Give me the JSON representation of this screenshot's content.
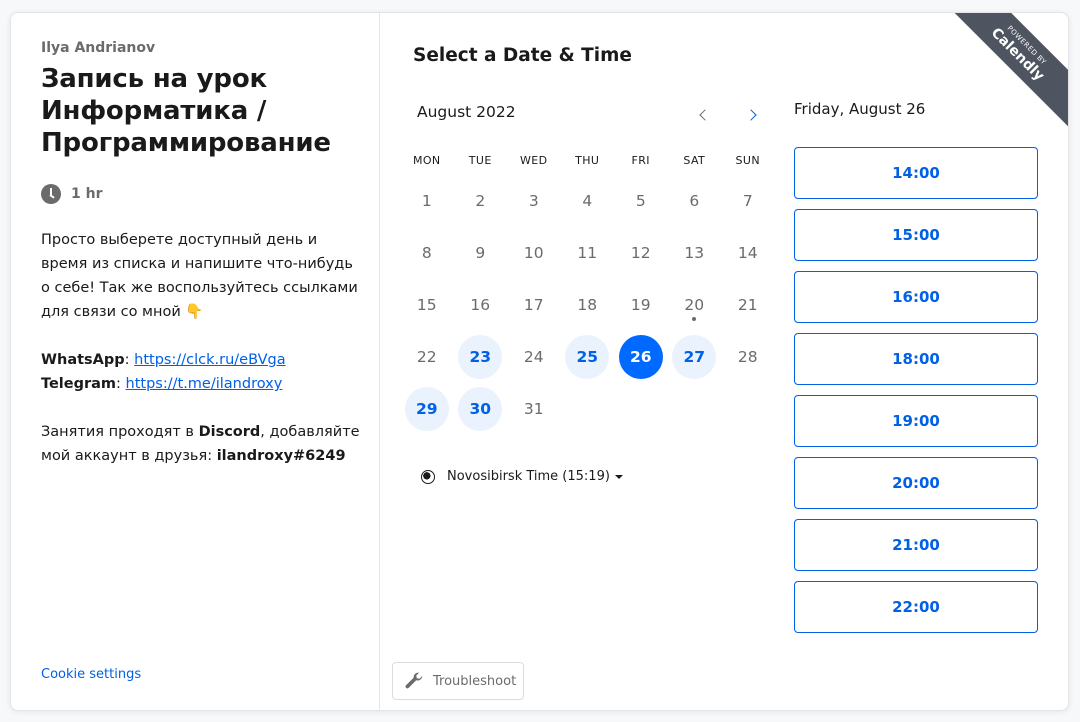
{
  "left": {
    "host_name": "Ilya Andrianov",
    "event_title": "Запись на урок Информатика / Программирование",
    "duration": "1 hr",
    "description": {
      "intro": "Просто выберете доступный день и время из списка и напишите что-нибудь о себе! Так же воспользуйтесь ссылками для связи со мной 👇",
      "whatsapp_label": "WhatsApp",
      "whatsapp_link": "https://clck.ru/eBVga",
      "telegram_label": "Telegram",
      "telegram_link": "https://t.me/ilandroxy",
      "discord_pre": "Занятия проходят в ",
      "discord_label": "Discord",
      "discord_post": ", добавляйте мой аккаунт в друзья: ",
      "discord_account": "ilandroxy#6249"
    },
    "cookie_settings": "Cookie settings"
  },
  "calendar": {
    "heading": "Select a Date & Time",
    "month_label": "August 2022",
    "weekdays": [
      "MON",
      "TUE",
      "WED",
      "THU",
      "FRI",
      "SAT",
      "SUN"
    ],
    "days": [
      {
        "n": "1",
        "state": "off"
      },
      {
        "n": "2",
        "state": "off"
      },
      {
        "n": "3",
        "state": "off"
      },
      {
        "n": "4",
        "state": "off"
      },
      {
        "n": "5",
        "state": "off"
      },
      {
        "n": "6",
        "state": "off"
      },
      {
        "n": "7",
        "state": "off"
      },
      {
        "n": "8",
        "state": "off"
      },
      {
        "n": "9",
        "state": "off"
      },
      {
        "n": "10",
        "state": "off"
      },
      {
        "n": "11",
        "state": "off"
      },
      {
        "n": "12",
        "state": "off"
      },
      {
        "n": "13",
        "state": "off"
      },
      {
        "n": "14",
        "state": "off"
      },
      {
        "n": "15",
        "state": "off"
      },
      {
        "n": "16",
        "state": "off"
      },
      {
        "n": "17",
        "state": "off"
      },
      {
        "n": "18",
        "state": "off"
      },
      {
        "n": "19",
        "state": "off"
      },
      {
        "n": "20",
        "state": "today"
      },
      {
        "n": "21",
        "state": "off"
      },
      {
        "n": "22",
        "state": "off"
      },
      {
        "n": "23",
        "state": "avail"
      },
      {
        "n": "24",
        "state": "off"
      },
      {
        "n": "25",
        "state": "avail"
      },
      {
        "n": "26",
        "state": "selected"
      },
      {
        "n": "27",
        "state": "avail"
      },
      {
        "n": "28",
        "state": "off"
      },
      {
        "n": "29",
        "state": "avail"
      },
      {
        "n": "30",
        "state": "avail"
      },
      {
        "n": "31",
        "state": "off"
      }
    ],
    "timezone": "Novosibirsk Time (15:19)",
    "troubleshoot_label": "Troubleshoot"
  },
  "times": {
    "selected_date": "Friday, August 26",
    "slots": [
      "14:00",
      "15:00",
      "16:00",
      "18:00",
      "19:00",
      "20:00",
      "21:00",
      "22:00"
    ]
  },
  "badge": {
    "powered_by": "POWERED BY",
    "brand": "Calendly"
  },
  "colors": {
    "accent": "#0069ff",
    "link": "#0060e6",
    "available_bg": "#eaf2fe",
    "badge_bg": "#4e5560"
  }
}
